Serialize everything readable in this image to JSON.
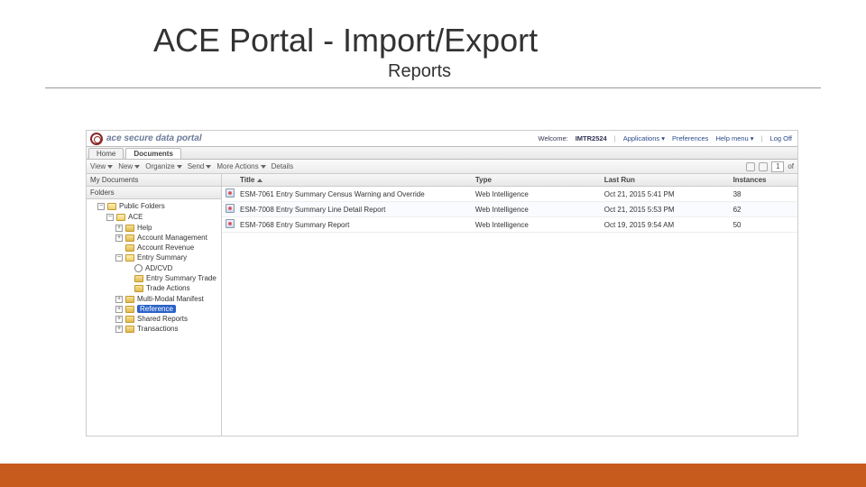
{
  "slide": {
    "title": "ACE Portal - Import/Export",
    "subtitle": "Reports"
  },
  "brand": "ace secure data portal",
  "header": {
    "welcome_label": "Welcome:",
    "user": "IMTR2524",
    "links": {
      "applications": "Applications",
      "preferences": "Preferences",
      "help": "Help menu",
      "logoff": "Log Off"
    }
  },
  "tabs": {
    "home": "Home",
    "documents": "Documents"
  },
  "toolbar": {
    "view": "View",
    "new": "New",
    "organize": "Organize",
    "send": "Send",
    "more": "More Actions",
    "details": "Details",
    "page": "1",
    "of_label": "of"
  },
  "sidebar": {
    "my_documents": "My Documents",
    "folders": "Folders",
    "tree": {
      "public": "Public Folders",
      "ace": "ACE",
      "help": "Help",
      "acct_mgmt": "Account Management",
      "acct_rev": "Account Revenue",
      "entry_summary": "Entry Summary",
      "adcvd": "AD/CVD",
      "es_trade": "Entry Summary Trade",
      "trade_actions": "Trade Actions",
      "multi_modal": "Multi-Modal Manifest",
      "reference": "Reference",
      "shared": "Shared Reports",
      "transactions": "Transactions"
    }
  },
  "columns": {
    "title": "Title",
    "type": "Type",
    "last_run": "Last Run",
    "instances": "Instances"
  },
  "rows": [
    {
      "title": "ESM-7061 Entry Summary Census Warning and Override",
      "type": "Web Intelligence",
      "last_run": "Oct 21, 2015 5:41 PM",
      "instances": "38"
    },
    {
      "title": "ESM-7008 Entry Summary Line Detail Report",
      "type": "Web Intelligence",
      "last_run": "Oct 21, 2015 5:53 PM",
      "instances": "62"
    },
    {
      "title": "ESM-7068 Entry Summary Report",
      "type": "Web Intelligence",
      "last_run": "Oct 19, 2015 9:54 AM",
      "instances": "50"
    }
  ]
}
